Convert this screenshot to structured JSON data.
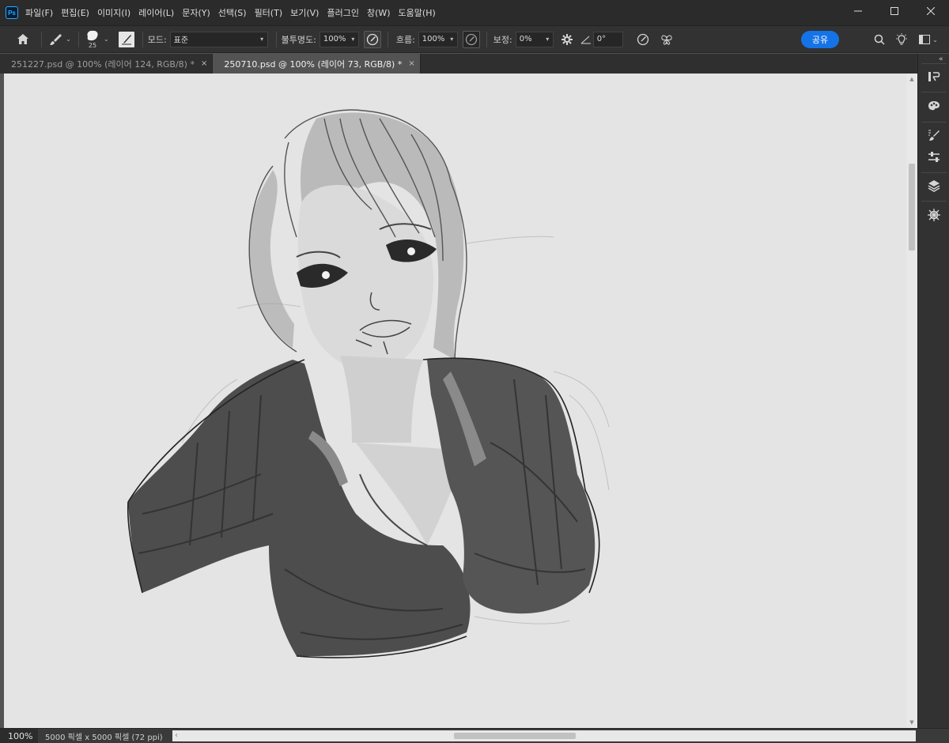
{
  "app": {
    "logo_text": "Ps",
    "menu": [
      "파일(F)",
      "편집(E)",
      "이미지(I)",
      "레이어(L)",
      "문자(Y)",
      "선택(S)",
      "필터(T)",
      "보기(V)",
      "플러그인",
      "창(W)",
      "도움말(H)"
    ]
  },
  "options": {
    "brush_size": "25",
    "mode_label": "모드:",
    "mode_value": "표준",
    "opacity_label": "불투명도:",
    "opacity_value": "100%",
    "flow_label": "흐름:",
    "flow_value": "100%",
    "smoothing_label": "보정:",
    "smoothing_value": "0%",
    "angle_value": "0°",
    "share_label": "공유"
  },
  "tabs": [
    {
      "label": "251227.psd @ 100% (레이어 124, RGB/8) *",
      "active": false
    },
    {
      "label": "250710.psd @ 100% (레이어 73, RGB/8) *",
      "active": true
    }
  ],
  "status": {
    "zoom": "100%",
    "doc_info": "5000 픽셀 x 5000 픽셀 (72 ppi)"
  },
  "colors": {
    "accent": "#1473e6",
    "canvas": "#e4e4e4",
    "chrome": "#323232"
  }
}
